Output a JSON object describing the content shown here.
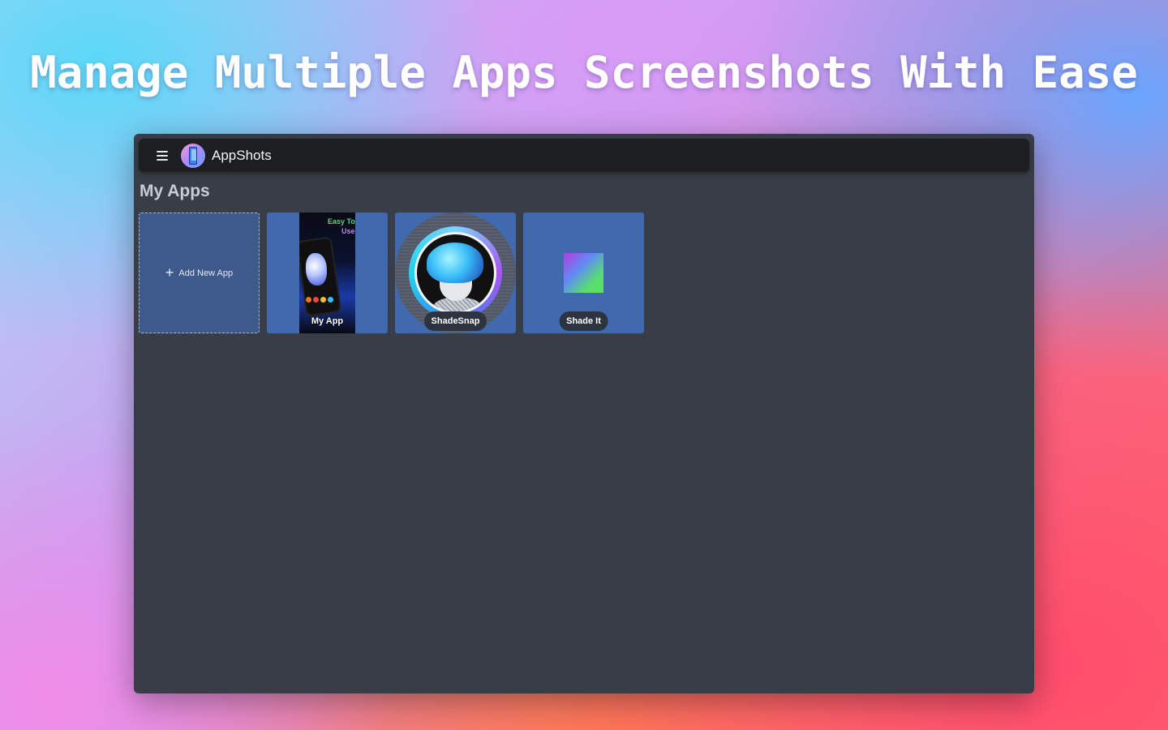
{
  "headline": "Manage Multiple Apps Screenshots With Ease",
  "appbar": {
    "menu_icon": "hamburger-menu-icon",
    "logo_icon": "appshots-logo-icon",
    "title": "AppShots"
  },
  "main": {
    "section_title": "My Apps",
    "add_card": {
      "icon": "plus-icon",
      "label": "Add New App"
    },
    "apps": [
      {
        "name": "My App",
        "thumbnail_text_1": "Easy To",
        "thumbnail_text_2": "Use"
      },
      {
        "name": "ShadeSnap"
      },
      {
        "name": "Shade It"
      }
    ]
  },
  "colors": {
    "window_bg": "#383d48",
    "appbar_bg": "#1c1e21",
    "card_bg": "#4169ae",
    "chip_bg": "#2d3440"
  }
}
